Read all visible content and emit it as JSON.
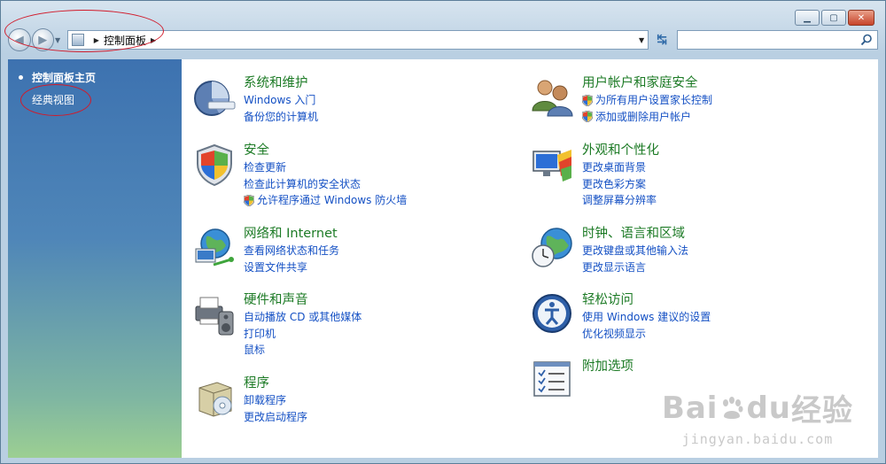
{
  "window": {
    "controls": {
      "minimize": "▁",
      "maximize": "▢",
      "close": "✕"
    }
  },
  "navbar": {
    "back_glyph": "◀",
    "forward_glyph": "▶",
    "dropdown_glyph": "▼",
    "breadcrumb_arrow": "▶",
    "location": "控制面板",
    "location_arrow": "▶",
    "address_dropdown": "▼",
    "refresh_glyph": "↹",
    "search_value": "",
    "search_placeholder": ""
  },
  "sidebar": {
    "home": "控制面板主页",
    "classic": "经典视图"
  },
  "categories": {
    "system": {
      "title": "系统和维护",
      "links": [
        "Windows 入门",
        "备份您的计算机"
      ]
    },
    "security": {
      "title": "安全",
      "links": [
        "检查更新",
        "检查此计算机的安全状态",
        "允许程序通过 Windows 防火墙"
      ]
    },
    "network": {
      "title": "网络和 Internet",
      "links": [
        "查看网络状态和任务",
        "设置文件共享"
      ]
    },
    "hardware": {
      "title": "硬件和声音",
      "links": [
        "自动播放 CD 或其他媒体",
        "打印机",
        "鼠标"
      ]
    },
    "programs": {
      "title": "程序",
      "links": [
        "卸载程序",
        "更改启动程序"
      ]
    },
    "users": {
      "title": "用户帐户和家庭安全",
      "links": [
        "为所有用户设置家长控制",
        "添加或删除用户帐户"
      ]
    },
    "appearance": {
      "title": "外观和个性化",
      "links": [
        "更改桌面背景",
        "更改色彩方案",
        "调整屏幕分辨率"
      ]
    },
    "clock": {
      "title": "时钟、语言和区域",
      "links": [
        "更改键盘或其他输入法",
        "更改显示语言"
      ]
    },
    "ease": {
      "title": "轻松访问",
      "links": [
        "使用 Windows 建议的设置",
        "优化视频显示"
      ]
    },
    "additional": {
      "title": "附加选项"
    }
  },
  "watermark": {
    "brand_a": "Bai",
    "brand_b": "du",
    "brand_c": "经验",
    "url": "jingyan.baidu.com"
  },
  "colors": {
    "title_green": "#1d7b26",
    "link_blue": "#1450c4",
    "annotation_red": "#d11a2a"
  }
}
